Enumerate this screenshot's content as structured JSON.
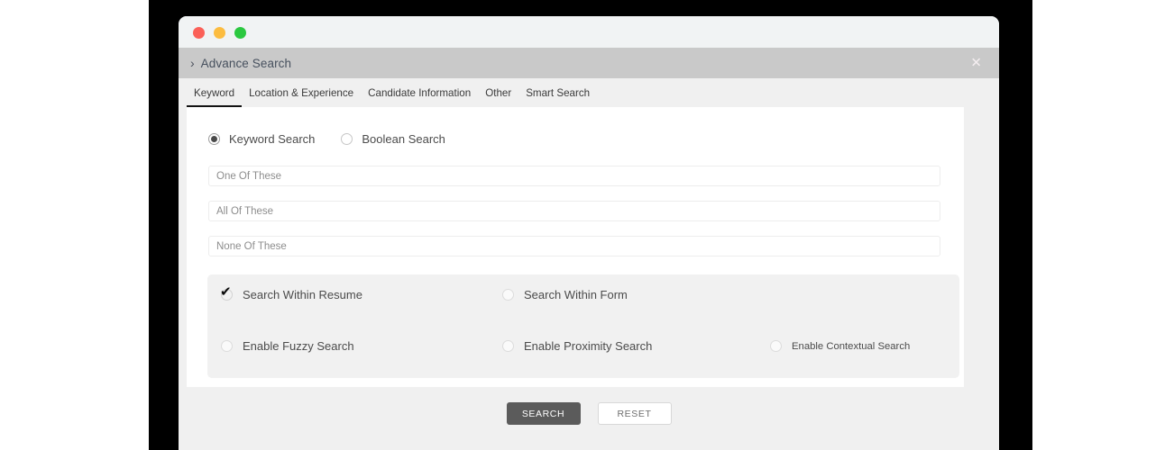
{
  "window": {
    "traffic_lights": [
      {
        "name": "close",
        "color": "#fb6058"
      },
      {
        "name": "minimize",
        "color": "#fcbc40"
      },
      {
        "name": "maximize",
        "color": "#2bc840"
      }
    ]
  },
  "modal": {
    "chevron": "›",
    "title": "Advance Search",
    "close_icon": "✕",
    "header_bg": "#c9c9c9"
  },
  "tabs": [
    {
      "label": "Keyword",
      "active": true
    },
    {
      "label": "Location & Experience",
      "active": false
    },
    {
      "label": "Candidate Information",
      "active": false
    },
    {
      "label": "Other",
      "active": false
    },
    {
      "label": "Smart Search",
      "active": false
    }
  ],
  "search_mode": {
    "options": [
      {
        "label": "Keyword Search",
        "selected": true
      },
      {
        "label": "Boolean Search",
        "selected": false
      }
    ]
  },
  "fields": [
    {
      "name": "one-of-these",
      "placeholder": "One Of These",
      "value": ""
    },
    {
      "name": "all-of-these",
      "placeholder": "All Of These",
      "value": ""
    },
    {
      "name": "none-of-these",
      "placeholder": "None Of These",
      "value": ""
    }
  ],
  "options": [
    {
      "label": "Search Within Resume",
      "checked": true
    },
    {
      "label": "Search Within Form",
      "checked": false
    },
    {
      "label": "Enable Fuzzy Search",
      "checked": false
    },
    {
      "label": "Enable Proximity Search",
      "checked": false
    },
    {
      "label": "Enable Contextual Search",
      "checked": false
    }
  ],
  "check_glyph": "✔",
  "actions": {
    "search_label": "SEARCH",
    "reset_label": "RESET",
    "search_bg": "#5b5b5b"
  }
}
